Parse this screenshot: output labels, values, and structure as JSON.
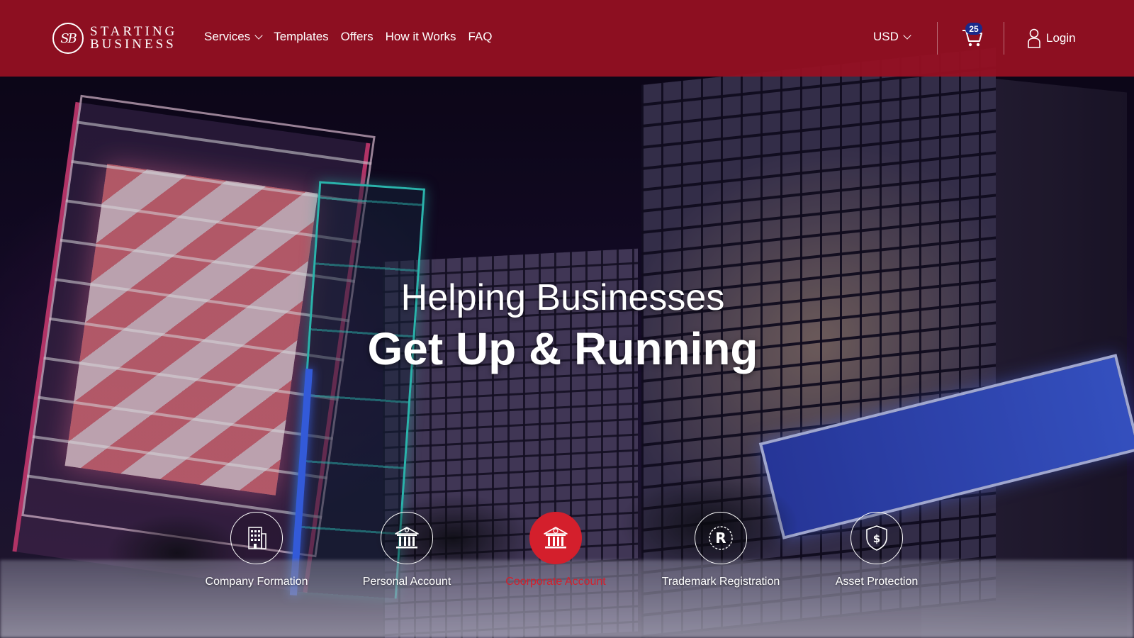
{
  "header": {
    "logo_mark": "SB",
    "logo_line1": "STARTING",
    "logo_line2": "BUSINESS",
    "nav": [
      {
        "label": "Services",
        "has_dropdown": true
      },
      {
        "label": "Templates"
      },
      {
        "label": "Offers"
      },
      {
        "label": "How it Works"
      },
      {
        "label": "FAQ"
      }
    ],
    "currency": "USD",
    "cart_count": "25",
    "login_label": "Login",
    "icons": {
      "cart": "cart-icon",
      "user": "user-icon",
      "chevron": "chevron-down-icon"
    }
  },
  "hero": {
    "line1": "Helping Businesses",
    "line2": "Get Up & Running"
  },
  "services": [
    {
      "label": "Company Formation",
      "icon": "building-icon",
      "active": false
    },
    {
      "label": "Personal Account",
      "icon": "bank-user-icon",
      "active": false
    },
    {
      "label": "Coorporate Account",
      "icon": "bank-dollar-icon",
      "active": true
    },
    {
      "label": "Trademark Registration",
      "icon": "trademark-icon",
      "active": false
    },
    {
      "label": "Asset Protection",
      "icon": "shield-dollar-icon",
      "active": false
    }
  ],
  "colors": {
    "brand_red": "#96101f",
    "active_red": "#d41f2c",
    "badge_blue": "#1a2a8a",
    "text_white": "#ffffff"
  }
}
